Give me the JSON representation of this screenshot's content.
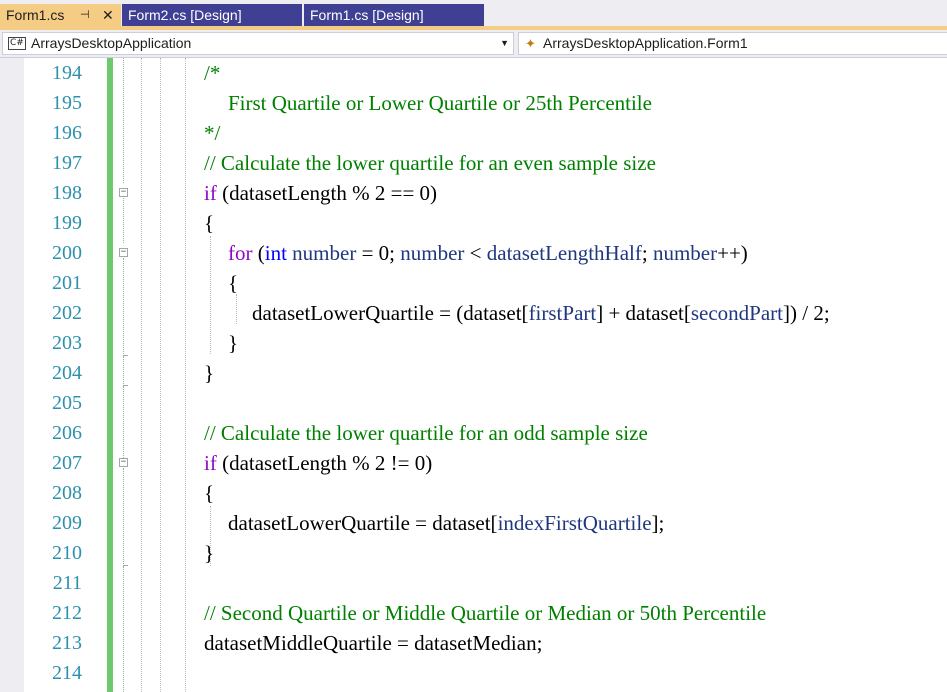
{
  "tabs": [
    {
      "label": "Form1.cs",
      "active": true,
      "pin_icon": "pin-icon",
      "close_icon": "close-icon"
    },
    {
      "label": "Form2.cs [Design]",
      "active": false
    },
    {
      "label": "Form1.cs [Design]",
      "active": false
    }
  ],
  "navbar": {
    "project_icon_text": "C#",
    "project": "ArraysDesktopApplication",
    "member": "ArraysDesktopApplication.Form1"
  },
  "line_numbers": [
    "194",
    "195",
    "196",
    "197",
    "198",
    "199",
    "200",
    "201",
    "202",
    "203",
    "204",
    "205",
    "206",
    "207",
    "208",
    "209",
    "210",
    "211",
    "212",
    "213",
    "214"
  ],
  "code": {
    "l194": "/*",
    "l195": "First Quartile or Lower Quartile or 25th Percentile",
    "l196": "*/",
    "l197": "// Calculate the lower quartile for an even sample size",
    "l198_kw": "if",
    "l198_rest": " (datasetLength % 2 == 0)",
    "l199": "{",
    "l200_kw": "for",
    "l200_a": " (",
    "l200_int": "int",
    "l200_b": " ",
    "l200_number": "number",
    "l200_c": " = 0; ",
    "l200_number2": "number",
    "l200_d": " < ",
    "l200_half": "datasetLengthHalf",
    "l200_e": "; ",
    "l200_number3": "number",
    "l200_f": "++)",
    "l201": "{",
    "l202_a": "datasetLowerQuartile = (dataset[",
    "l202_first": "firstPart",
    "l202_b": "] + dataset[",
    "l202_second": "secondPart",
    "l202_c": "]) / 2;",
    "l203": "}",
    "l204": "}",
    "l206": "// Calculate the lower quartile for an odd sample size",
    "l207_kw": "if",
    "l207_rest": " (datasetLength % 2 != 0)",
    "l208": "{",
    "l209_a": "datasetLowerQuartile = dataset[",
    "l209_idx": "indexFirstQuartile",
    "l209_b": "];",
    "l210": "}",
    "l212": "// Second Quartile or Middle Quartile or Median or 50th Percentile",
    "l213": "datasetMiddleQuartile = datasetMedian;"
  }
}
